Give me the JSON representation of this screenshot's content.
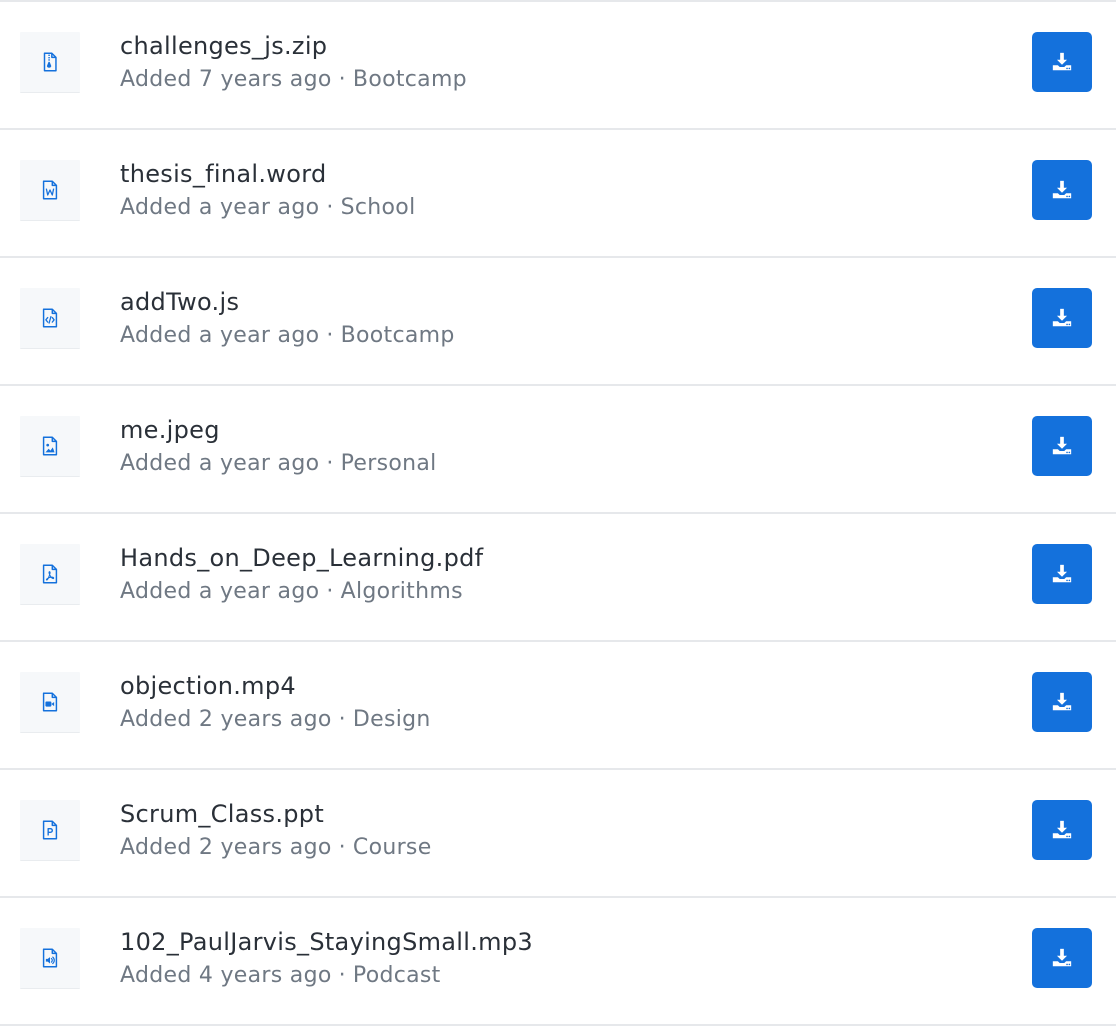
{
  "accent_color": "#1471dc",
  "separator": "·",
  "files": [
    {
      "name": "challenges_js.zip",
      "added": "Added 7 years ago",
      "category": "Bootcamp",
      "icon": "zip-file-icon",
      "download_icon": "download-icon"
    },
    {
      "name": "thesis_final.word",
      "added": "Added a year ago",
      "category": "School",
      "icon": "word-file-icon",
      "download_icon": "download-icon"
    },
    {
      "name": "addTwo.js",
      "added": "Added a year ago",
      "category": "Bootcamp",
      "icon": "code-file-icon",
      "download_icon": "download-icon"
    },
    {
      "name": "me.jpeg",
      "added": "Added a year ago",
      "category": "Personal",
      "icon": "image-file-icon",
      "download_icon": "download-icon"
    },
    {
      "name": "Hands_on_Deep_Learning.pdf",
      "added": "Added a year ago",
      "category": "Algorithms",
      "icon": "pdf-file-icon",
      "download_icon": "download-icon"
    },
    {
      "name": "objection.mp4",
      "added": "Added 2 years ago",
      "category": "Design",
      "icon": "video-file-icon",
      "download_icon": "download-icon"
    },
    {
      "name": "Scrum_Class.ppt",
      "added": "Added 2 years ago",
      "category": "Course",
      "icon": "powerpoint-file-icon",
      "download_icon": "download-icon"
    },
    {
      "name": "102_PaulJarvis_StayingSmall.mp3",
      "added": "Added 4 years ago",
      "category": "Podcast",
      "icon": "audio-file-icon",
      "download_icon": "download-icon"
    }
  ]
}
